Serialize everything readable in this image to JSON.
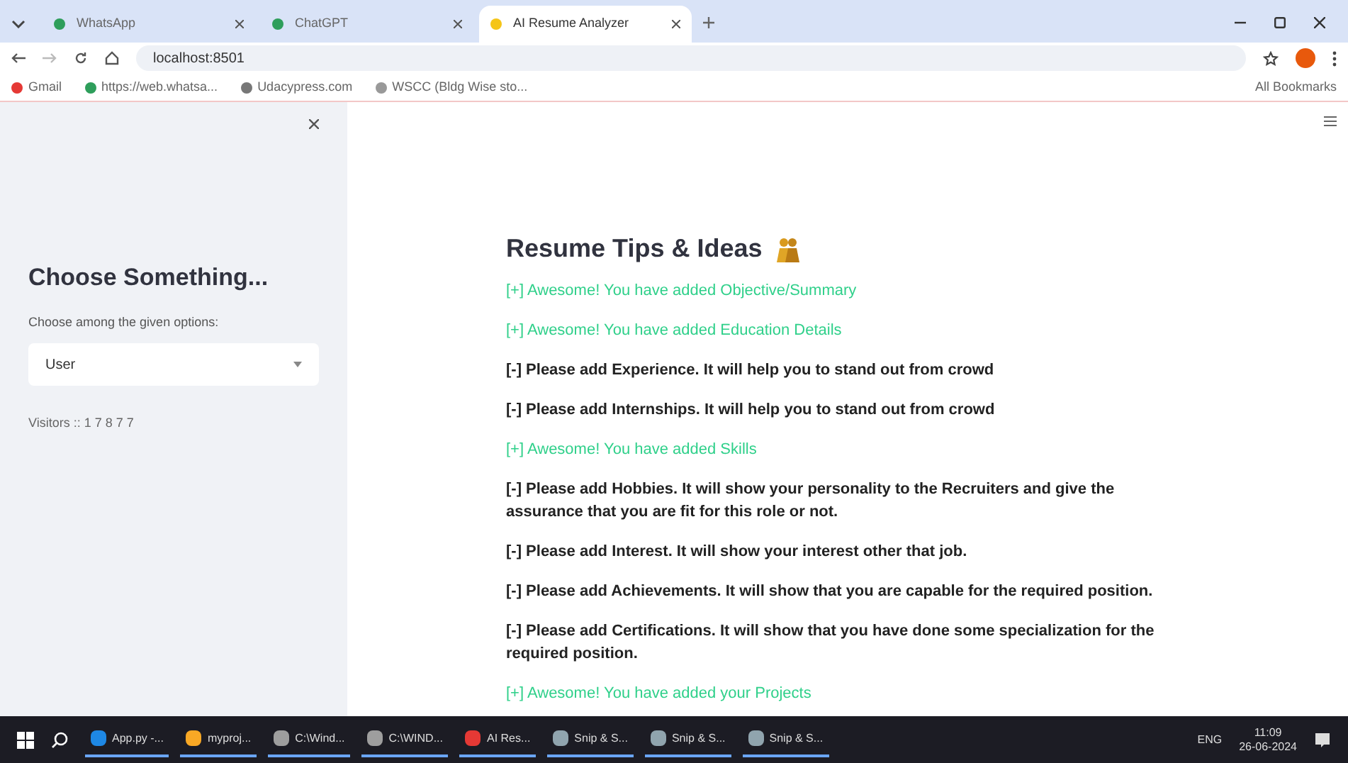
{
  "browser": {
    "tabs": [
      {
        "label": "WhatsApp",
        "selected": false
      },
      {
        "label": "ChatGPT",
        "selected": false
      },
      {
        "label": "AI Resume Analyzer",
        "selected": true
      }
    ],
    "address": "localhost:8501",
    "bookmarks": [
      "Gmail",
      "https://web.whatsa...",
      "Udacypress.com",
      "WSCC (Bldg Wise sto..."
    ],
    "all_bookmarks": "All Bookmarks"
  },
  "sidebar": {
    "heading": "Choose Something...",
    "select_label": "Choose among the given options:",
    "select_value": "User",
    "visitors": "Visitors :: 1 7 8 7 7"
  },
  "main": {
    "title": "Resume Tips & Ideas",
    "tips": [
      {
        "kind": "added",
        "text": "[+] Awesome! You have added Objective/Summary"
      },
      {
        "kind": "added",
        "text": "[+] Awesome! You have added Education Details"
      },
      {
        "kind": "missing",
        "text": "[-] Please add Experience. It will help you to stand out from crowd"
      },
      {
        "kind": "missing",
        "text": "[-] Please add Internships. It will help you to stand out from crowd"
      },
      {
        "kind": "added",
        "text": "[+] Awesome! You have added Skills"
      },
      {
        "kind": "missing",
        "text": "[-] Please add Hobbies. It will show your personality to the Recruiters and give the assurance that you are fit for this role or not."
      },
      {
        "kind": "missing",
        "text": "[-] Please add Interest. It will show your interest other that job."
      },
      {
        "kind": "missing",
        "text": "[-] Please add Achievements. It will show that you are capable for the required position."
      },
      {
        "kind": "missing",
        "text": "[-] Please add Certifications. It will show that you have done some specialization for the required position."
      },
      {
        "kind": "added",
        "text": "[+] Awesome! You have added your Projects"
      }
    ]
  },
  "taskbar": {
    "apps": [
      {
        "label": "App.py -...",
        "color": "#1e88e5"
      },
      {
        "label": "myproj...",
        "color": "#f9a825"
      },
      {
        "label": "C:\\Wind...",
        "color": "#9e9e9e"
      },
      {
        "label": "C:\\WIND...",
        "color": "#9e9e9e"
      },
      {
        "label": "AI Res...",
        "color": "#e53935"
      },
      {
        "label": "Snip & S...",
        "color": "#90a4ae"
      },
      {
        "label": "Snip & S...",
        "color": "#90a4ae"
      },
      {
        "label": "Snip & S...",
        "color": "#90a4ae"
      }
    ],
    "language": "ENG",
    "time": "11:09",
    "date": "26-06-2024"
  }
}
